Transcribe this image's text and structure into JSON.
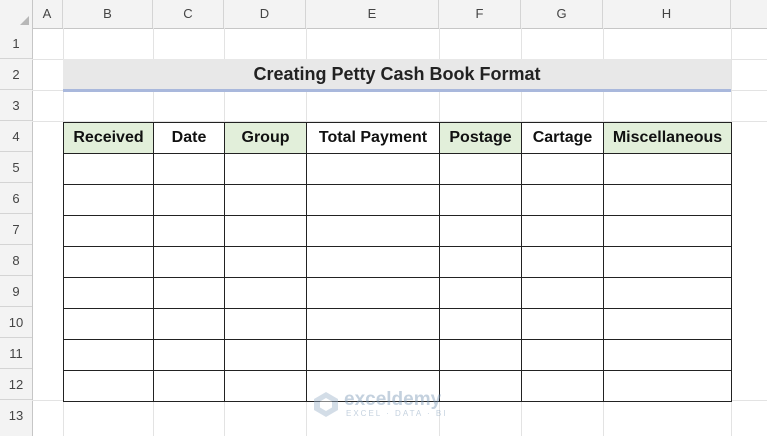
{
  "columns": [
    "A",
    "B",
    "C",
    "D",
    "E",
    "F",
    "G",
    "H"
  ],
  "rows": [
    "1",
    "2",
    "3",
    "4",
    "5",
    "6",
    "7",
    "8",
    "9",
    "10",
    "11",
    "12",
    "13"
  ],
  "title": "Creating Petty Cash Book Format",
  "table": {
    "headers": [
      {
        "label": "Received",
        "highlight": true
      },
      {
        "label": "Date",
        "highlight": false
      },
      {
        "label": "Group",
        "highlight": true
      },
      {
        "label": "Total Payment",
        "highlight": false
      },
      {
        "label": "Postage",
        "highlight": true
      },
      {
        "label": "Cartage",
        "highlight": false
      },
      {
        "label": "Miscellaneous",
        "highlight": true
      }
    ],
    "empty_rows": 8
  },
  "colors": {
    "header_green": "#e2efda",
    "title_band": "#e8e8e8",
    "title_underline": "#a9b8dc"
  },
  "watermark": {
    "name": "exceldemy",
    "tagline": "EXCEL · DATA · BI",
    "icon": "exceldemy-logo-icon"
  }
}
